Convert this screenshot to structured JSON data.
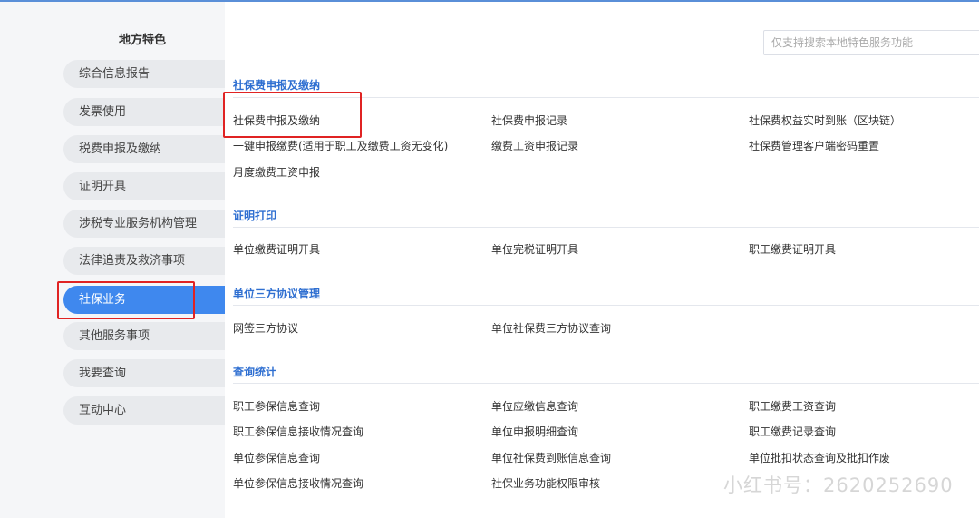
{
  "sidebar": {
    "title": "地方特色",
    "items": [
      {
        "label": "综合信息报告"
      },
      {
        "label": "发票使用"
      },
      {
        "label": "税费申报及缴纳"
      },
      {
        "label": "证明开具"
      },
      {
        "label": "涉税专业服务机构管理"
      },
      {
        "label": "法律追责及救济事项"
      },
      {
        "label": "社保业务"
      },
      {
        "label": "其他服务事项"
      },
      {
        "label": "我要查询"
      },
      {
        "label": "互动中心"
      }
    ],
    "active_index": 6
  },
  "search": {
    "placeholder": "仅支持搜索本地特色服务功能",
    "value": ""
  },
  "sections": [
    {
      "title": "社保费申报及缴纳",
      "rows": [
        [
          "社保费申报及缴纳",
          "社保费申报记录",
          "社保费权益实时到账（区块链）"
        ],
        [
          "一键申报缴费(适用于职工及缴费工资无变化)",
          "缴费工资申报记录",
          "社保费管理客户端密码重置"
        ],
        [
          "月度缴费工资申报"
        ]
      ]
    },
    {
      "title": "证明打印",
      "rows": [
        [
          "单位缴费证明开具",
          "单位完税证明开具",
          "职工缴费证明开具"
        ]
      ]
    },
    {
      "title": "单位三方协议管理",
      "rows": [
        [
          "网签三方协议",
          "单位社保费三方协议查询"
        ]
      ]
    },
    {
      "title": "查询统计",
      "rows": [
        [
          "职工参保信息查询",
          "单位应缴信息查询",
          "职工缴费工资查询"
        ],
        [
          "职工参保信息接收情况查询",
          "单位申报明细查询",
          "职工缴费记录查询"
        ],
        [
          "单位参保信息查询",
          "单位社保费到账信息查询",
          "单位批扣状态查询及批扣作废"
        ],
        [
          "单位参保信息接收情况查询",
          "社保业务功能权限审核"
        ]
      ]
    }
  ],
  "watermark": "小红书号：2620252690",
  "colors": {
    "accent": "#3f88ee",
    "section_title": "#2f6fd1",
    "highlight": "#e02323"
  }
}
